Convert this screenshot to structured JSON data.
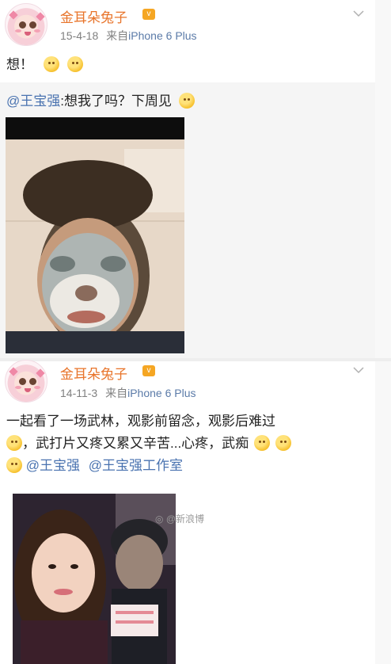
{
  "post1": {
    "username": "金耳朵兔子",
    "date": "15-4-18",
    "source_prefix": "来自",
    "source": "iPhone 6 Plus",
    "text": "想！",
    "emojis": [
      "grin-emoji",
      "tongue-emoji"
    ]
  },
  "repost": {
    "mention": "@王宝强",
    "text": ":想我了吗？下周见",
    "emoji": "wink-tongue-emoji"
  },
  "post2": {
    "username": "金耳朵兔子",
    "date": "14-11-3",
    "source_prefix": "来自",
    "source": "iPhone 6 Plus",
    "text_line1": "一起看了一场武林，观影前留念，观影后难过",
    "text_line2": "，武打片又疼又累又辛苦...心疼，武痴",
    "mention1": "@王宝强",
    "mention2": "@王宝强工作室",
    "watermark": "@新浪博"
  },
  "colors": {
    "username": "#e8742a",
    "mention": "#4a73b0",
    "meta": "#808080",
    "repost_bg": "#f5f5f5"
  }
}
